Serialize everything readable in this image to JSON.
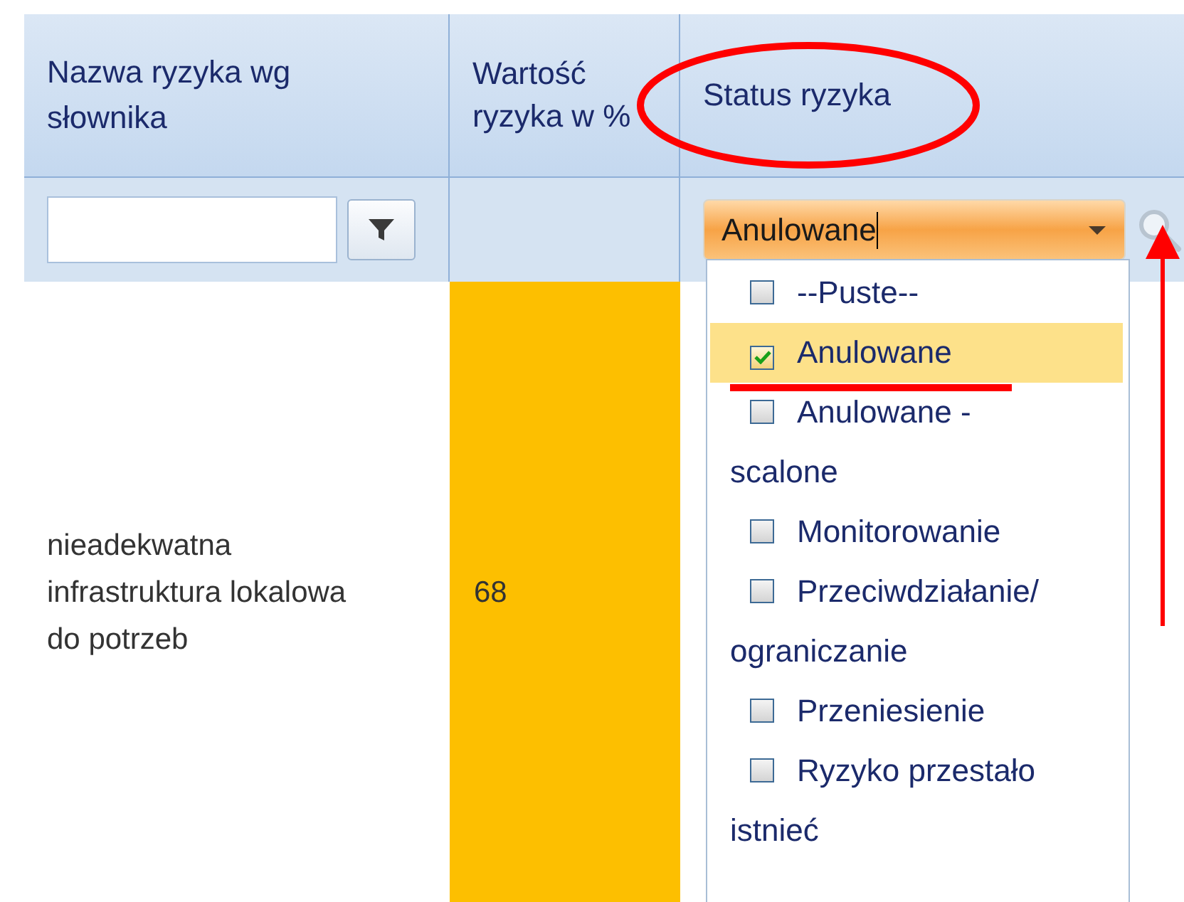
{
  "table": {
    "columns": [
      {
        "label": "Nazwa ryzyka wg słownika"
      },
      {
        "label": "Wartość ryzyka w %"
      },
      {
        "label": "Status ryzyka"
      }
    ],
    "filters": {
      "status_filter": {
        "value": "Anulowane",
        "focused": true
      }
    },
    "rows": [
      {
        "name": "nieadekwatna infrastruktura lokalowa do potrzeb",
        "value": "68",
        "color": "#fdbf00"
      }
    ]
  },
  "status_dropdown": {
    "items": [
      {
        "label": "--Puste--",
        "checked": false,
        "selected": false
      },
      {
        "label": "Anulowane",
        "checked": true,
        "selected": true
      },
      {
        "label": "Anulowane - scalone",
        "checked": false,
        "selected": false
      },
      {
        "label": "Monitorowanie",
        "checked": false,
        "selected": false
      },
      {
        "label": "Przeciwdziałanie/ ograniczanie",
        "checked": false,
        "selected": false
      },
      {
        "label": "Przeniesienie",
        "checked": false,
        "selected": false
      },
      {
        "label": "Ryzyko przestało istnieć",
        "checked": false,
        "selected": false
      }
    ]
  }
}
